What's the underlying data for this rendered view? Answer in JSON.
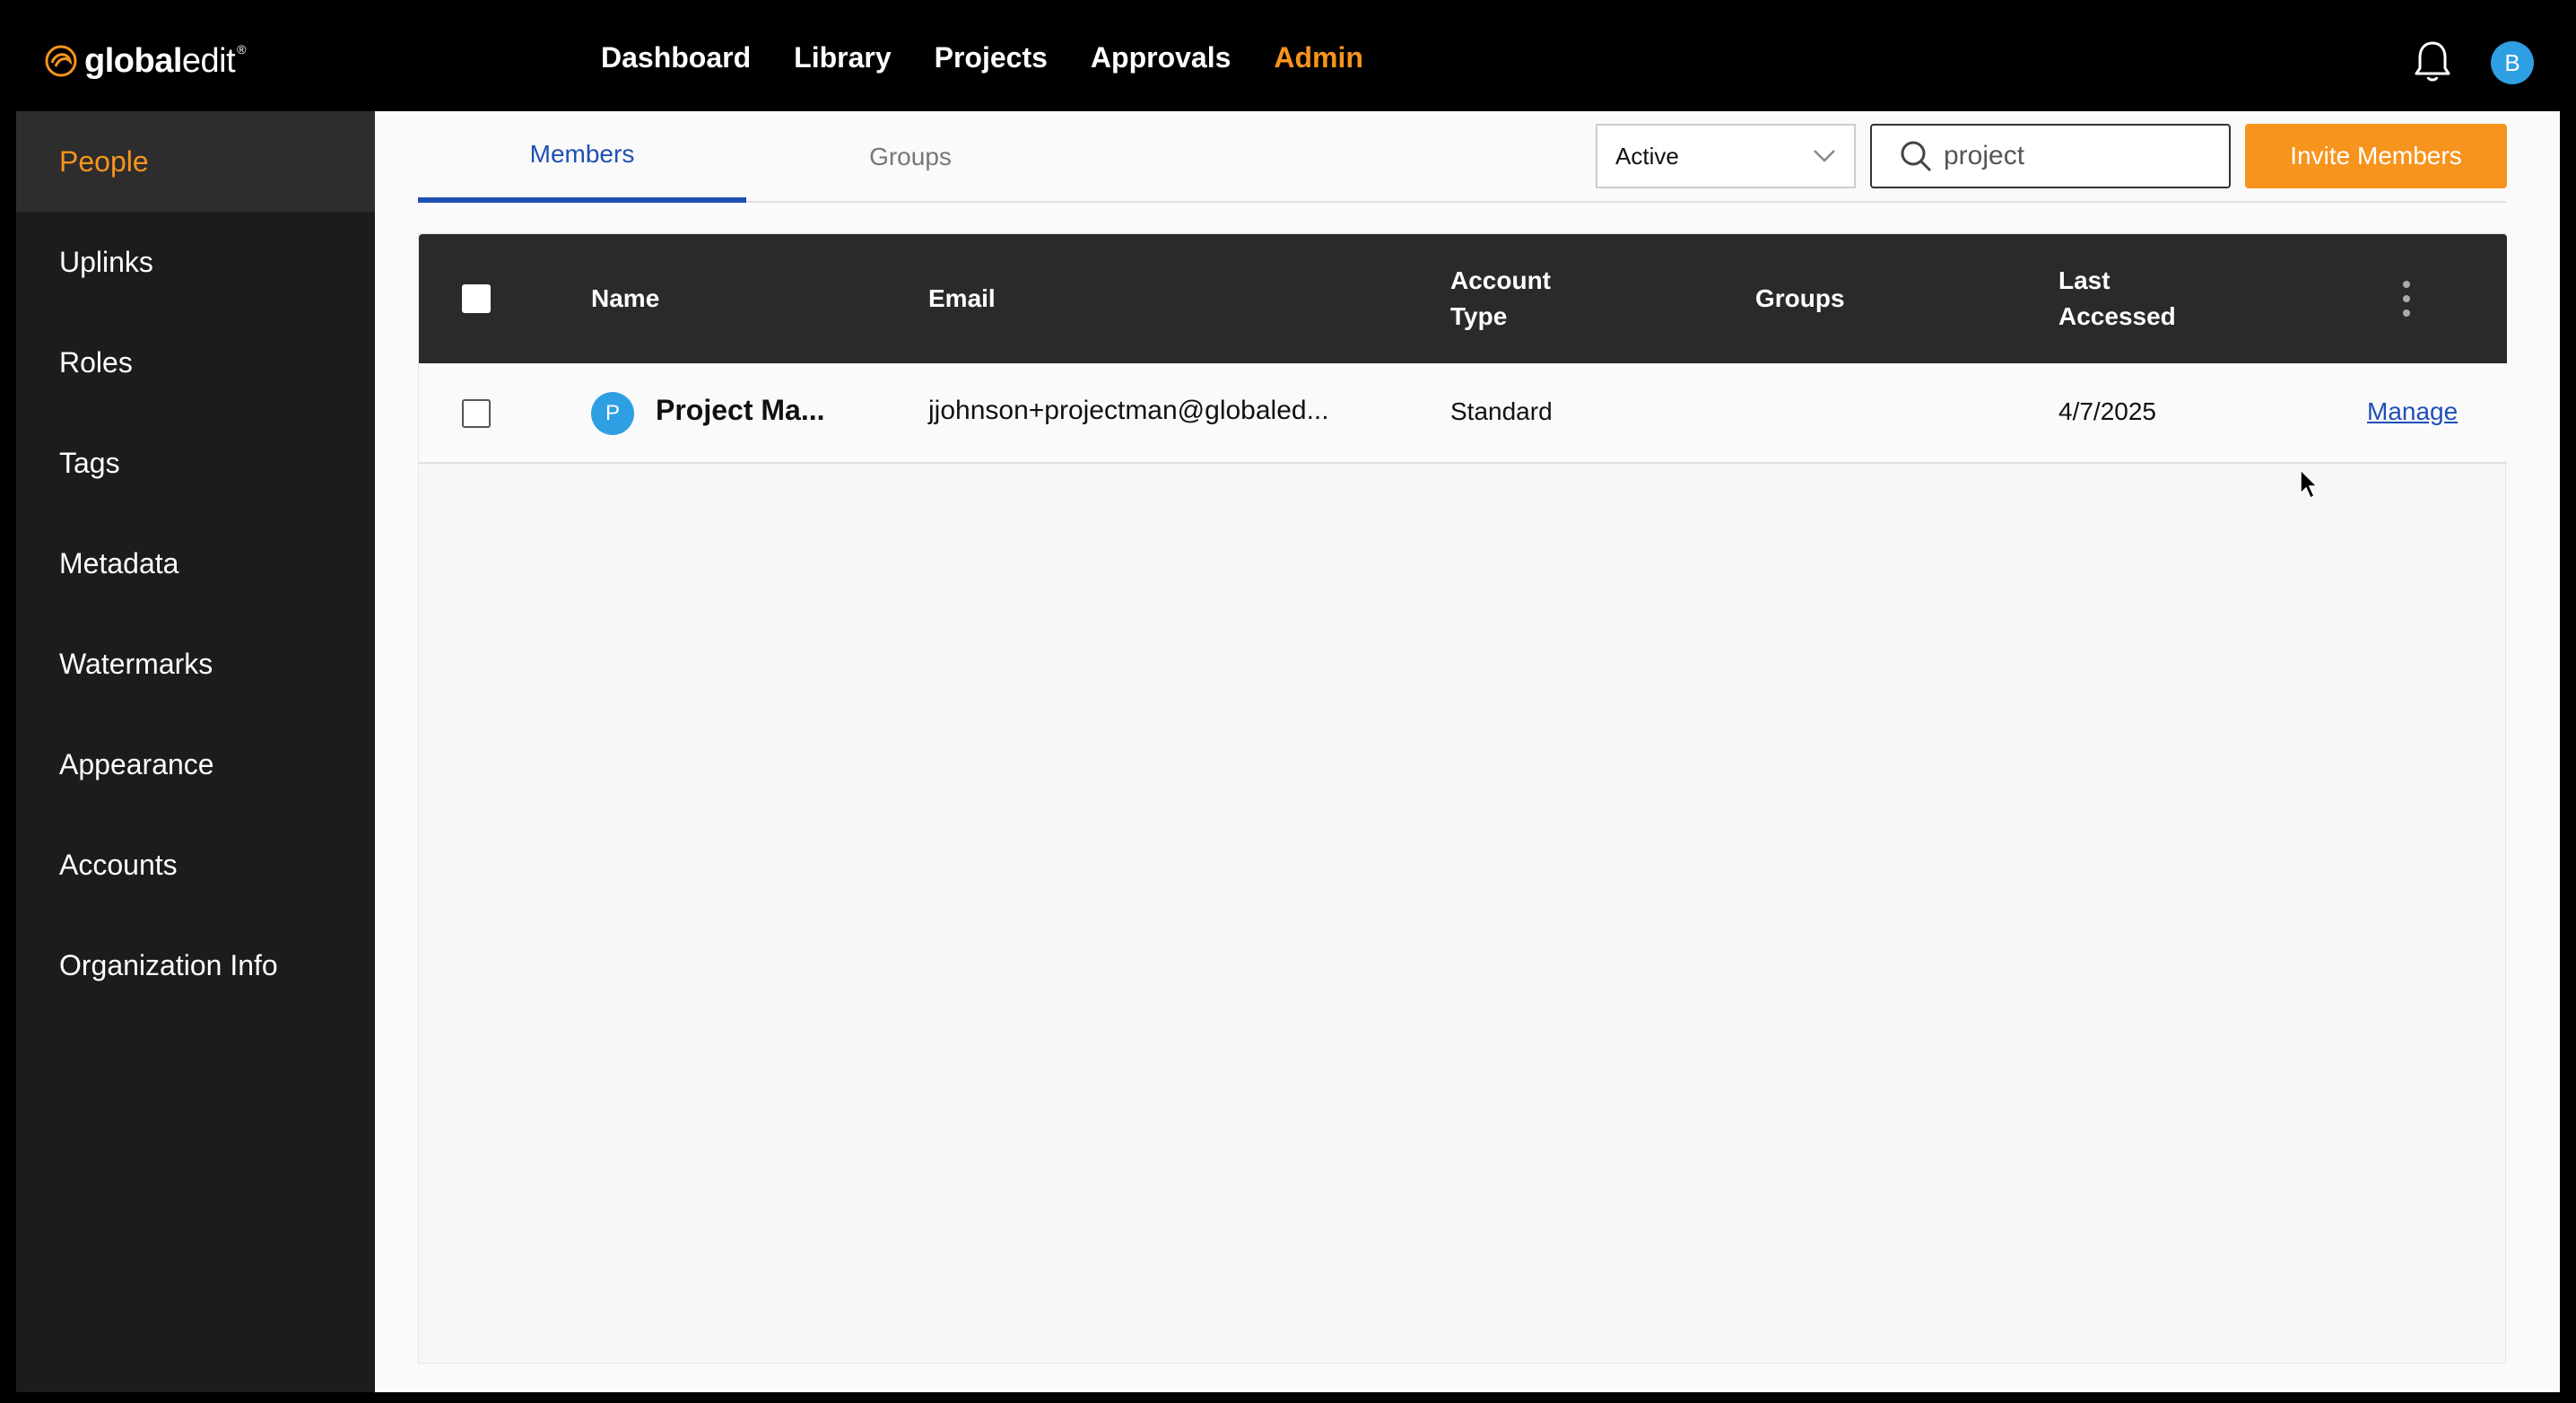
{
  "brand": {
    "logo_bold": "global",
    "logo_light": "edit",
    "trademark": "®"
  },
  "nav": {
    "items": [
      "Dashboard",
      "Library",
      "Projects",
      "Approvals",
      "Admin"
    ],
    "active": "Admin"
  },
  "user": {
    "initial": "B"
  },
  "sidebar": {
    "items": [
      "People",
      "Uplinks",
      "Roles",
      "Tags",
      "Metadata",
      "Watermarks",
      "Appearance",
      "Accounts",
      "Organization Info"
    ],
    "active": "People"
  },
  "tabs": {
    "members": "Members",
    "groups": "Groups",
    "active": "Members"
  },
  "filter": {
    "status_value": "Active"
  },
  "search": {
    "value": "project"
  },
  "actions": {
    "invite_label": "Invite Members"
  },
  "table": {
    "headers": {
      "name": "Name",
      "email": "Email",
      "account_type_line1": "Account",
      "account_type_line2": "Type",
      "groups": "Groups",
      "last_accessed_line1": "Last",
      "last_accessed_line2": "Accessed"
    },
    "rows": [
      {
        "avatar_initial": "P",
        "name": "Project Ma...",
        "email": "jjohnson+projectman@globaled...",
        "account_type": "Standard",
        "groups": "",
        "last_accessed": "4/7/2025",
        "action": "Manage"
      }
    ]
  },
  "colors": {
    "accent": "#f7941d",
    "link": "#1f4fb5",
    "avatar": "#2f9fe3",
    "header_bg": "#2a2a2a"
  }
}
